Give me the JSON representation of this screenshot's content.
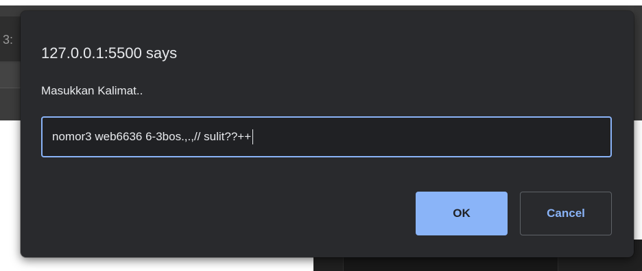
{
  "background": {
    "partial_text": "3:"
  },
  "dialog": {
    "title": "127.0.0.1:5500 says",
    "message": "Masukkan Kalimat..",
    "input_value": "nomor3 web6636 6-3bos.,.,// sulit??++",
    "ok_label": "OK",
    "cancel_label": "Cancel",
    "colors": {
      "background": "#292a2d",
      "accent": "#8ab4f8",
      "text": "#e8eaed",
      "input_background": "#202124"
    }
  }
}
